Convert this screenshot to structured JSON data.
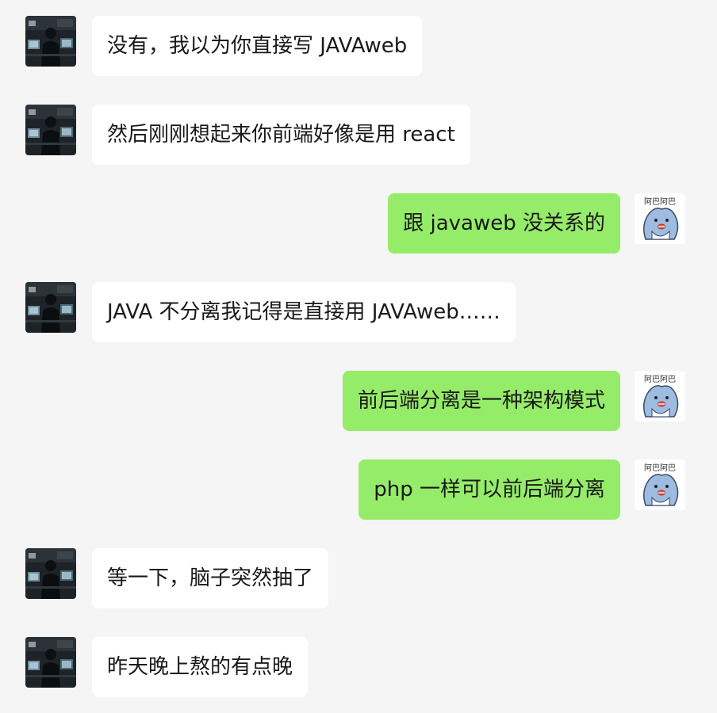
{
  "chat": {
    "messages": [
      {
        "side": "left",
        "text": "没有，我以为你直接写 JAVAweb"
      },
      {
        "side": "left",
        "text": "然后刚刚想起来你前端好像是用 react"
      },
      {
        "side": "right",
        "text": "跟 javaweb 没关系的"
      },
      {
        "side": "left",
        "text": "JAVA 不分离我记得是直接用 JAVAweb……"
      },
      {
        "side": "right",
        "text": "前后端分离是一种架构模式"
      },
      {
        "side": "right",
        "text": "php 一样可以前后端分离"
      },
      {
        "side": "left",
        "text": "等一下，脑子突然抽了"
      },
      {
        "side": "left",
        "text": "昨天晚上熬的有点晚"
      }
    ],
    "self_avatar_caption": "阿巴阿巴",
    "colors": {
      "background": "#f5f5f5",
      "incoming_bubble": "#ffffff",
      "outgoing_bubble": "#95ec69",
      "text": "#191919"
    },
    "icons": {
      "incoming_avatar": "dark-room-computer-avatar-icon",
      "outgoing_avatar": "shark-sticker-avatar-icon"
    }
  }
}
